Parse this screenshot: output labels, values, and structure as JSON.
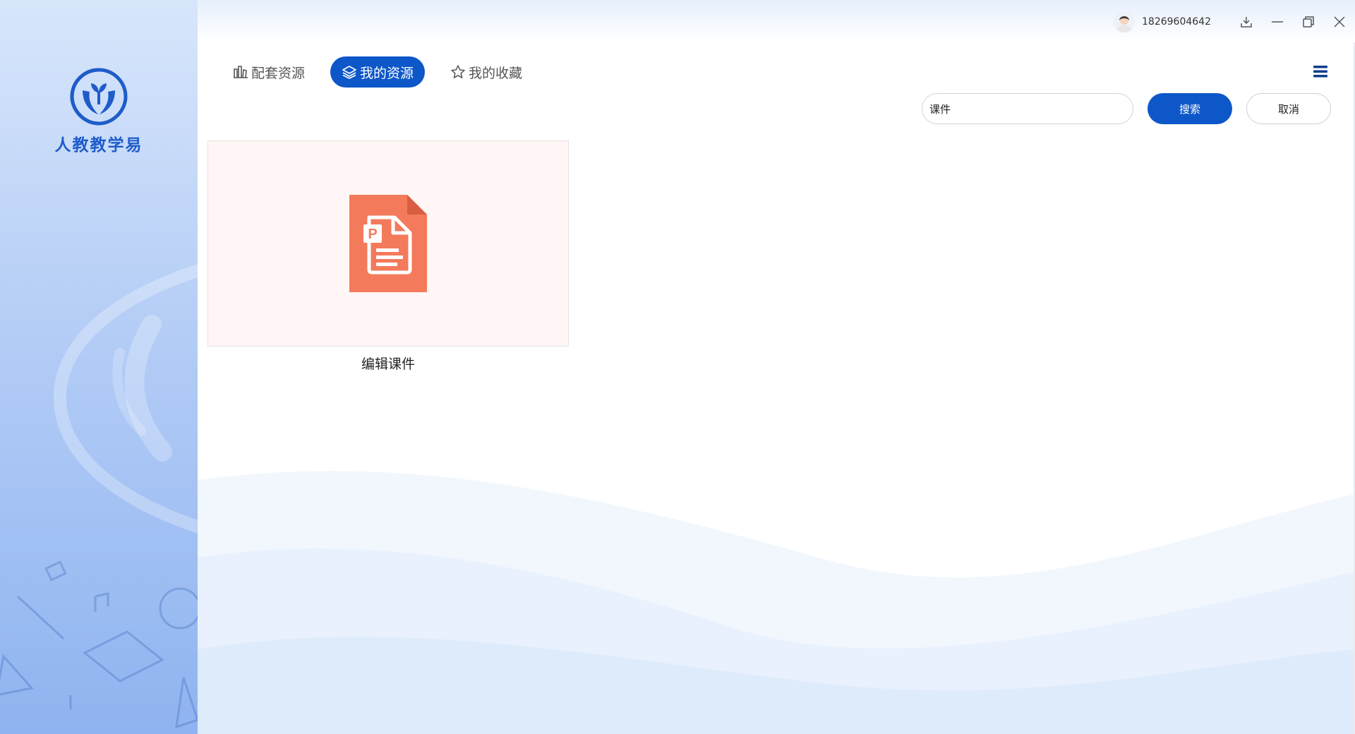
{
  "app": {
    "name": "人教教学易"
  },
  "titlebar": {
    "user_phone": "18269604642",
    "icons": [
      "avatar-icon",
      "download-icon",
      "minimize-icon",
      "restore-icon",
      "close-icon"
    ]
  },
  "tabs": [
    {
      "label": "配套资源",
      "icon": "books-icon",
      "active": false
    },
    {
      "label": "我的资源",
      "icon": "layers-icon",
      "active": true
    },
    {
      "label": "我的收藏",
      "icon": "star-icon",
      "active": false
    }
  ],
  "search": {
    "value": "课件",
    "search_label": "搜索",
    "cancel_label": "取消"
  },
  "resources": [
    {
      "title": "编辑课件",
      "type": "ppt-file-icon"
    }
  ],
  "colors": {
    "accent": "#0d57c9",
    "ppt_icon": "#f47a5c",
    "card_bg": "#fff6f5"
  }
}
